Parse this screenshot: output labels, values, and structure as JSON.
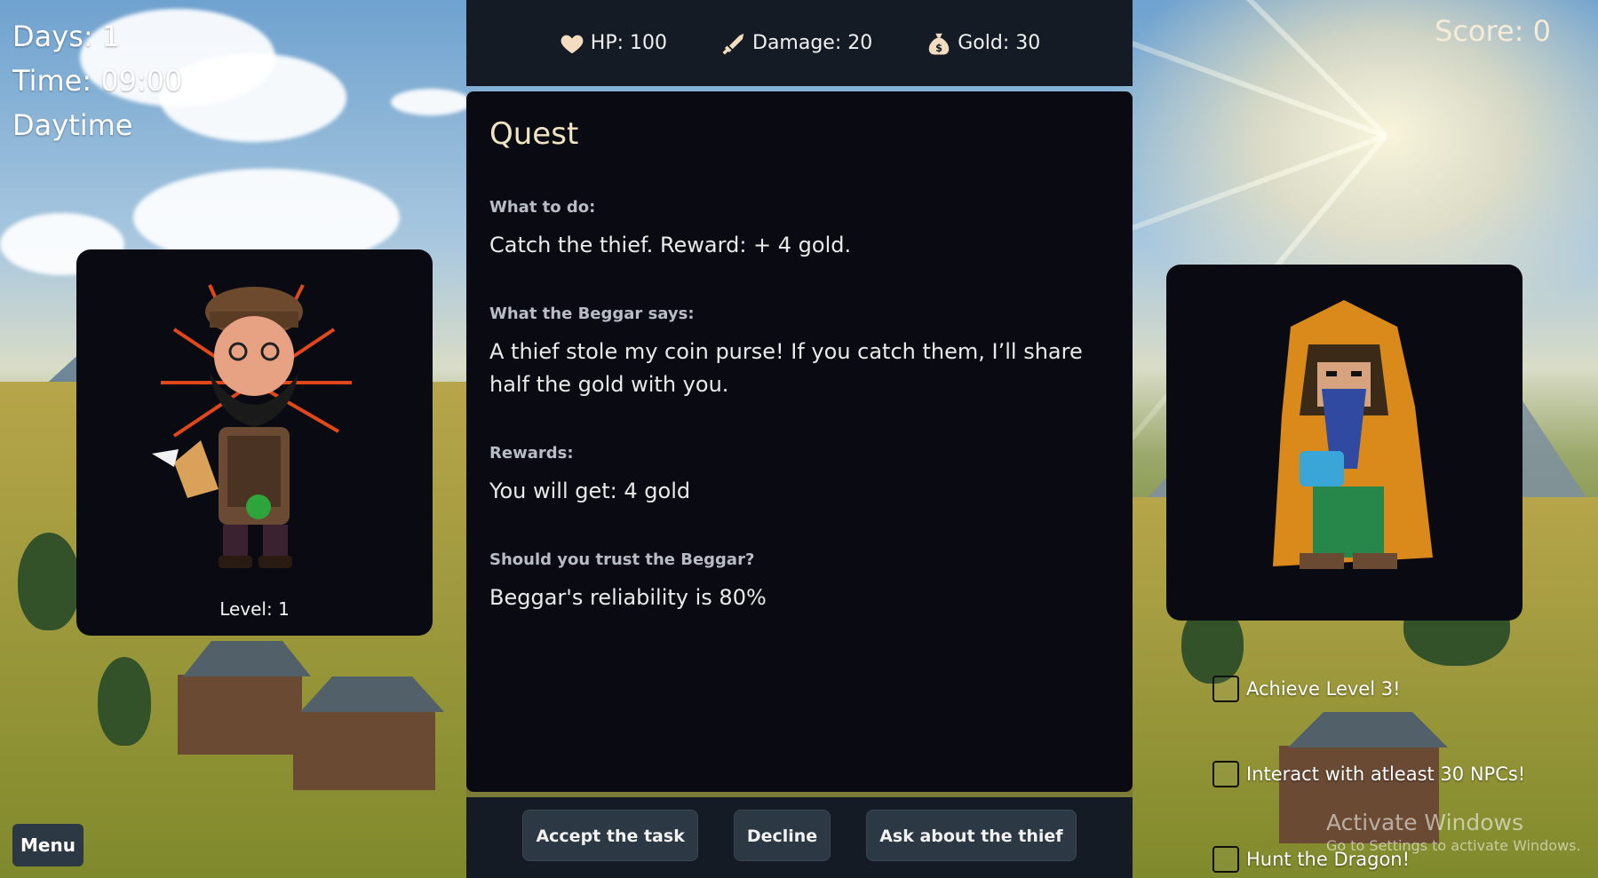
{
  "hud": {
    "days": "Days: 1",
    "time": "Time: 09:00",
    "period": "Daytime",
    "score": "Score: 0"
  },
  "stats": {
    "hp": "HP: 100",
    "damage": "Damage: 20",
    "gold": "Gold: 30"
  },
  "quest": {
    "title": "Quest",
    "what_label": "What to do:",
    "what_text": "Catch the thief. Reward: + 4 gold.",
    "says_label": "What the Beggar says:",
    "says_text": "A thief stole my coin purse! If you catch them, I’ll share half the gold with you.",
    "rewards_label": "Rewards:",
    "rewards_text": "You will get: 4 gold",
    "trust_label": "Should you trust the Beggar?",
    "trust_text": "Beggar's reliability is 80%"
  },
  "actions": {
    "accept": "Accept the task",
    "decline": "Decline",
    "ask": "Ask about the thief"
  },
  "player": {
    "level": "Level: 1"
  },
  "achievements": [
    {
      "label": "Achieve Level 3!",
      "checked": false
    },
    {
      "label": "Interact with atleast 30 NPCs!",
      "checked": false
    },
    {
      "label": "Hunt the Dragon!",
      "checked": false
    }
  ],
  "menu_label": "Menu",
  "watermark": {
    "title": "Activate Windows",
    "subtitle": "Go to Settings to activate Windows."
  },
  "icons": {
    "hp": "heart-icon",
    "damage": "sword-icon",
    "gold": "money-bag-icon"
  }
}
